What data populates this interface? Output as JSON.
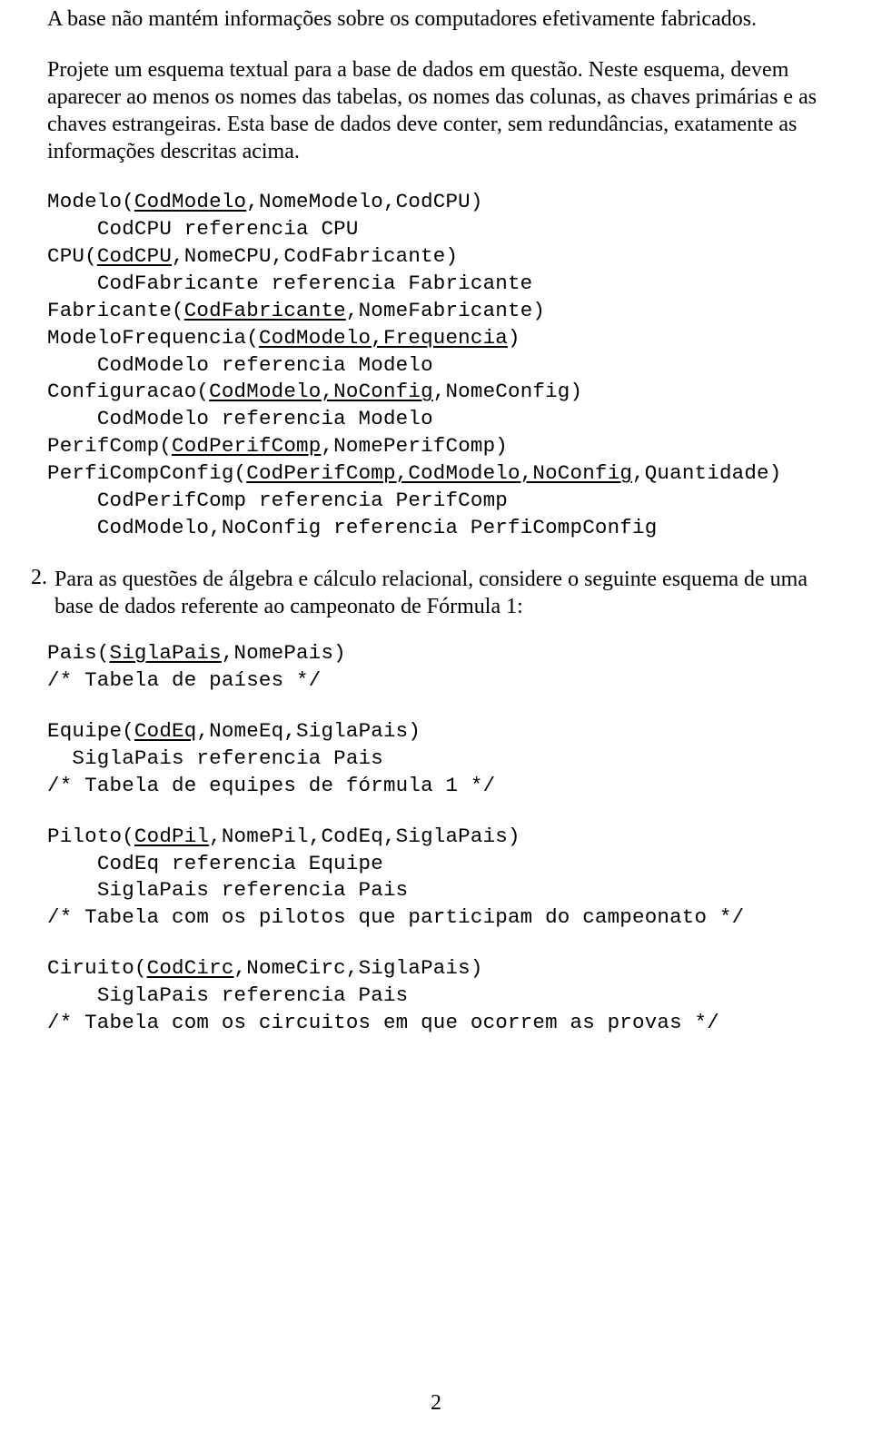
{
  "para1": "A base não mantém informações sobre os computadores efetivamente fabricados.",
  "para2": "Projete um esquema textual para a base de dados em questão. Neste esquema, devem aparecer ao menos os nomes das tabelas, os nomes das colunas, as chaves primárias e as chaves estrangeiras. Esta base de dados deve conter, sem redundâncias, exatamente as informações descritas acima.",
  "schema1": {
    "lines": [
      {
        "segments": [
          {
            "t": "Modelo("
          },
          {
            "t": "CodModelo",
            "u": true
          },
          {
            "t": ",NomeModelo,CodCPU)"
          }
        ]
      },
      {
        "indent": "    ",
        "segments": [
          {
            "t": "CodCPU referencia CPU"
          }
        ]
      },
      {
        "segments": [
          {
            "t": "CPU("
          },
          {
            "t": "CodCPU",
            "u": true
          },
          {
            "t": ",NomeCPU,CodFabricante)"
          }
        ]
      },
      {
        "indent": "    ",
        "segments": [
          {
            "t": "CodFabricante referencia Fabricante"
          }
        ]
      },
      {
        "segments": [
          {
            "t": "Fabricante("
          },
          {
            "t": "CodFabricante",
            "u": true
          },
          {
            "t": ",NomeFabricante)"
          }
        ]
      },
      {
        "segments": [
          {
            "t": "ModeloFrequencia("
          },
          {
            "t": "CodModelo,Frequencia",
            "u": true
          },
          {
            "t": ")"
          }
        ]
      },
      {
        "indent": "    ",
        "segments": [
          {
            "t": "CodModelo referencia Modelo"
          }
        ]
      },
      {
        "segments": [
          {
            "t": "Configuracao("
          },
          {
            "t": "CodModelo,NoConfig",
            "u": true
          },
          {
            "t": ",NomeConfig)"
          }
        ]
      },
      {
        "indent": "    ",
        "segments": [
          {
            "t": "CodModelo referencia Modelo"
          }
        ]
      },
      {
        "segments": [
          {
            "t": "PerifComp("
          },
          {
            "t": "CodPerifComp",
            "u": true
          },
          {
            "t": ",NomePerifComp)"
          }
        ]
      },
      {
        "segments": [
          {
            "t": "PerfiCompConfig("
          },
          {
            "t": "CodPerifComp,CodModelo,NoConfig",
            "u": true
          },
          {
            "t": ",Quantidade)"
          }
        ]
      },
      {
        "indent": "    ",
        "segments": [
          {
            "t": "CodPerifComp referencia PerifComp"
          }
        ]
      },
      {
        "indent": "    ",
        "segments": [
          {
            "t": "CodModelo,NoConfig referencia PerfiCompConfig"
          }
        ]
      }
    ]
  },
  "item2": {
    "marker": "2.",
    "text": "Para as questões de álgebra e cálculo relacional, considere o seguinte esquema de uma base de dados referente ao campeonato de Fórmula 1:"
  },
  "schema2": {
    "groups": [
      {
        "lines": [
          {
            "segments": [
              {
                "t": "Pais("
              },
              {
                "t": "SiglaPais",
                "u": true
              },
              {
                "t": ",NomePais)"
              }
            ]
          },
          {
            "segments": [
              {
                "t": "/* Tabela de países */"
              }
            ]
          }
        ]
      },
      {
        "lines": [
          {
            "segments": [
              {
                "t": "Equipe("
              },
              {
                "t": "CodEq",
                "u": true
              },
              {
                "t": ",NomeEq,SiglaPais)"
              }
            ]
          },
          {
            "indent": "  ",
            "segments": [
              {
                "t": "SiglaPais referencia Pais"
              }
            ]
          },
          {
            "segments": [
              {
                "t": "/* Tabela de equipes de fórmula 1 */"
              }
            ]
          }
        ]
      },
      {
        "lines": [
          {
            "segments": [
              {
                "t": "Piloto("
              },
              {
                "t": "CodPil",
                "u": true
              },
              {
                "t": ",NomePil,CodEq,SiglaPais)"
              }
            ]
          },
          {
            "indent": "    ",
            "segments": [
              {
                "t": "CodEq referencia Equipe"
              }
            ]
          },
          {
            "indent": "    ",
            "segments": [
              {
                "t": "SiglaPais referencia Pais"
              }
            ]
          },
          {
            "segments": [
              {
                "t": "/* Tabela com os pilotos que participam do campeonato */"
              }
            ]
          }
        ]
      },
      {
        "lines": [
          {
            "segments": [
              {
                "t": "Ciruito("
              },
              {
                "t": "CodCirc",
                "u": true
              },
              {
                "t": ",NomeCirc,SiglaPais)"
              }
            ]
          },
          {
            "indent": "    ",
            "segments": [
              {
                "t": "SiglaPais referencia Pais"
              }
            ]
          },
          {
            "segments": [
              {
                "t": "/* Tabela com os circuitos em que ocorrem as provas */"
              }
            ]
          }
        ]
      }
    ]
  },
  "page_number": "2"
}
